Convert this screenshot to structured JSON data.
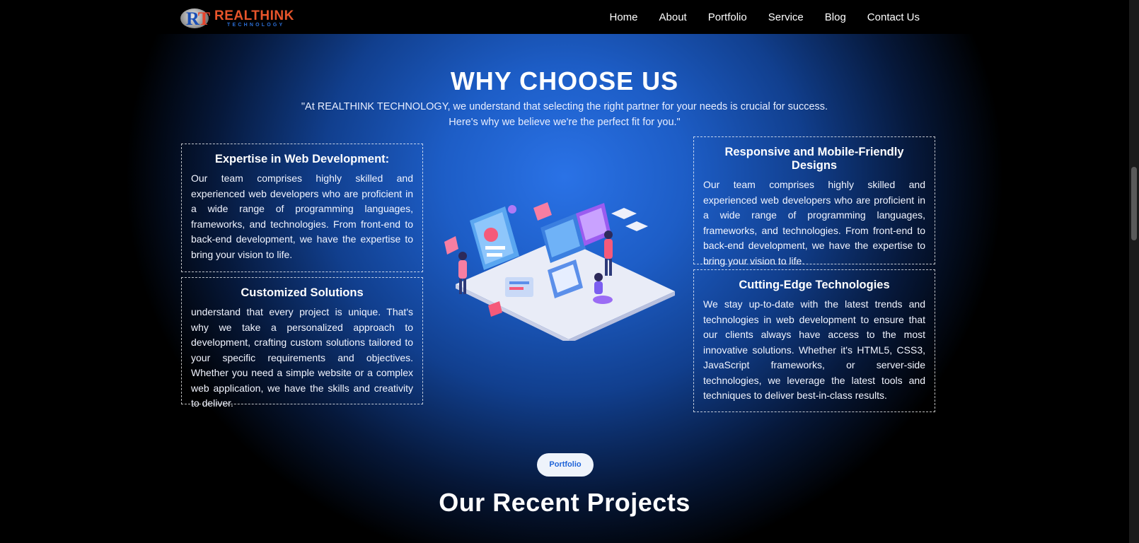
{
  "nav": {
    "logo": {
      "mark_r": "R",
      "mark_t": "T",
      "brand": "REALTHINK",
      "tagline": "TECHNOLOGY"
    },
    "links": [
      "Home",
      "About",
      "Portfolio",
      "Service",
      "Blog",
      "Contact Us"
    ]
  },
  "section": {
    "title": "WHY CHOOSE US",
    "intro_line1": "\"At REALTHINK TECHNOLOGY, we understand that selecting the right partner for your needs is crucial for success.",
    "intro_line2": "Here's why we believe we're the perfect fit for you.\""
  },
  "cards": [
    {
      "title": "Expertise in Web Development:",
      "body": "Our team comprises highly skilled and experienced web developers who are proficient in a wide range of programming languages, frameworks, and technologies. From front-end to back-end development, we have the expertise to bring your vision to life."
    },
    {
      "title": "Customized Solutions",
      "body": "understand that every project is unique. That's why we take a personalized approach to development, crafting custom solutions tailored to your specific requirements and objectives. Whether you need a simple website or a complex web application, we have the skills and creativity to deliver."
    },
    {
      "title": "Responsive and Mobile-Friendly Designs",
      "body": "Our team comprises highly skilled and experienced web developers who are proficient in a wide range of programming languages, frameworks, and technologies. From front-end to back-end development, we have the expertise to bring your vision to life."
    },
    {
      "title": "Cutting-Edge Technologies",
      "body": "We stay up-to-date with the latest trends and technologies in web development to ensure that our clients always have access to the most innovative solutions. Whether it's HTML5, CSS3, JavaScript frameworks, or server-side technologies, we leverage the latest tools and techniques to deliver best-in-class results."
    }
  ],
  "portfolio": {
    "pill": "Portfolio",
    "title": "Our Recent Projects"
  },
  "colors": {
    "accent": "#1e63d8",
    "brand_orange": "#e8552b",
    "nav_bg": "#000000"
  }
}
